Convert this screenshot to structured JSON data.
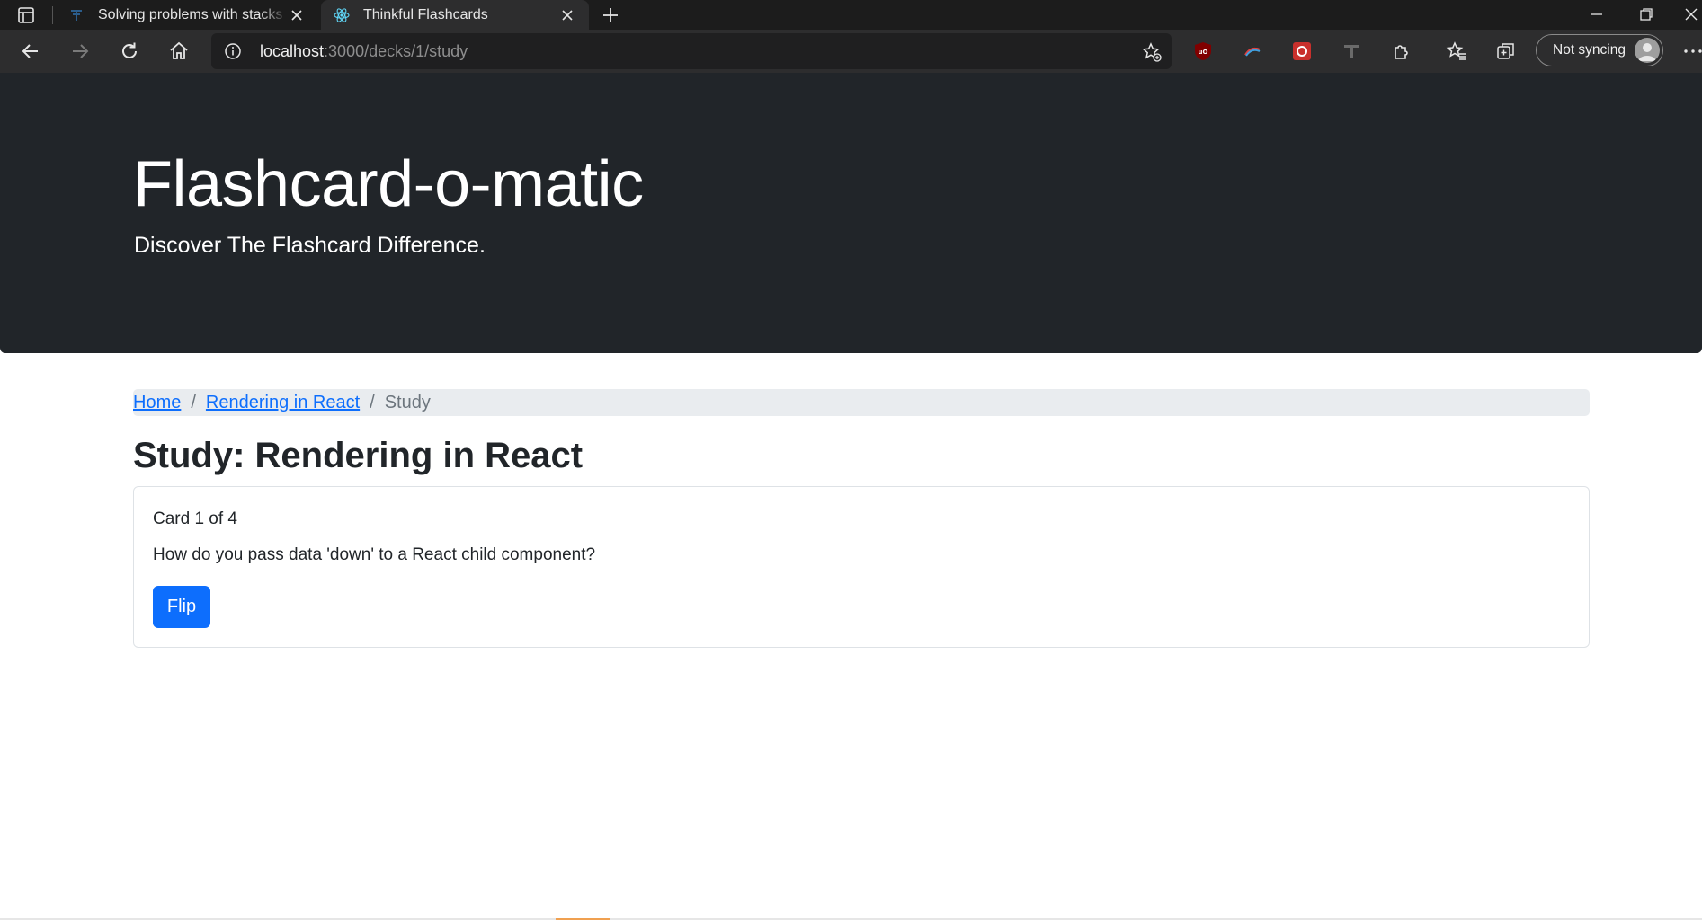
{
  "browser": {
    "tabs": [
      {
        "title": "Solving problems with stacks and queues",
        "active": false
      },
      {
        "title": "Thinkful Flashcards",
        "active": true
      }
    ],
    "address": {
      "host": "localhost",
      "path": ":3000/decks/1/study"
    },
    "profile_label": "Not syncing"
  },
  "header": {
    "title": "Flashcard-o-matic",
    "subtitle": "Discover The Flashcard Difference."
  },
  "breadcrumb": {
    "home": "Home",
    "deck": "Rendering in React",
    "current": "Study",
    "separator": "/"
  },
  "page": {
    "title": "Study: Rendering in React"
  },
  "card": {
    "count": "Card 1 of 4",
    "front": "How do you pass data 'down' to a React child component?",
    "flip_label": "Flip"
  },
  "colors": {
    "hero_bg": "#212529",
    "link": "#0d6efd",
    "primary_button": "#0d6efd"
  }
}
